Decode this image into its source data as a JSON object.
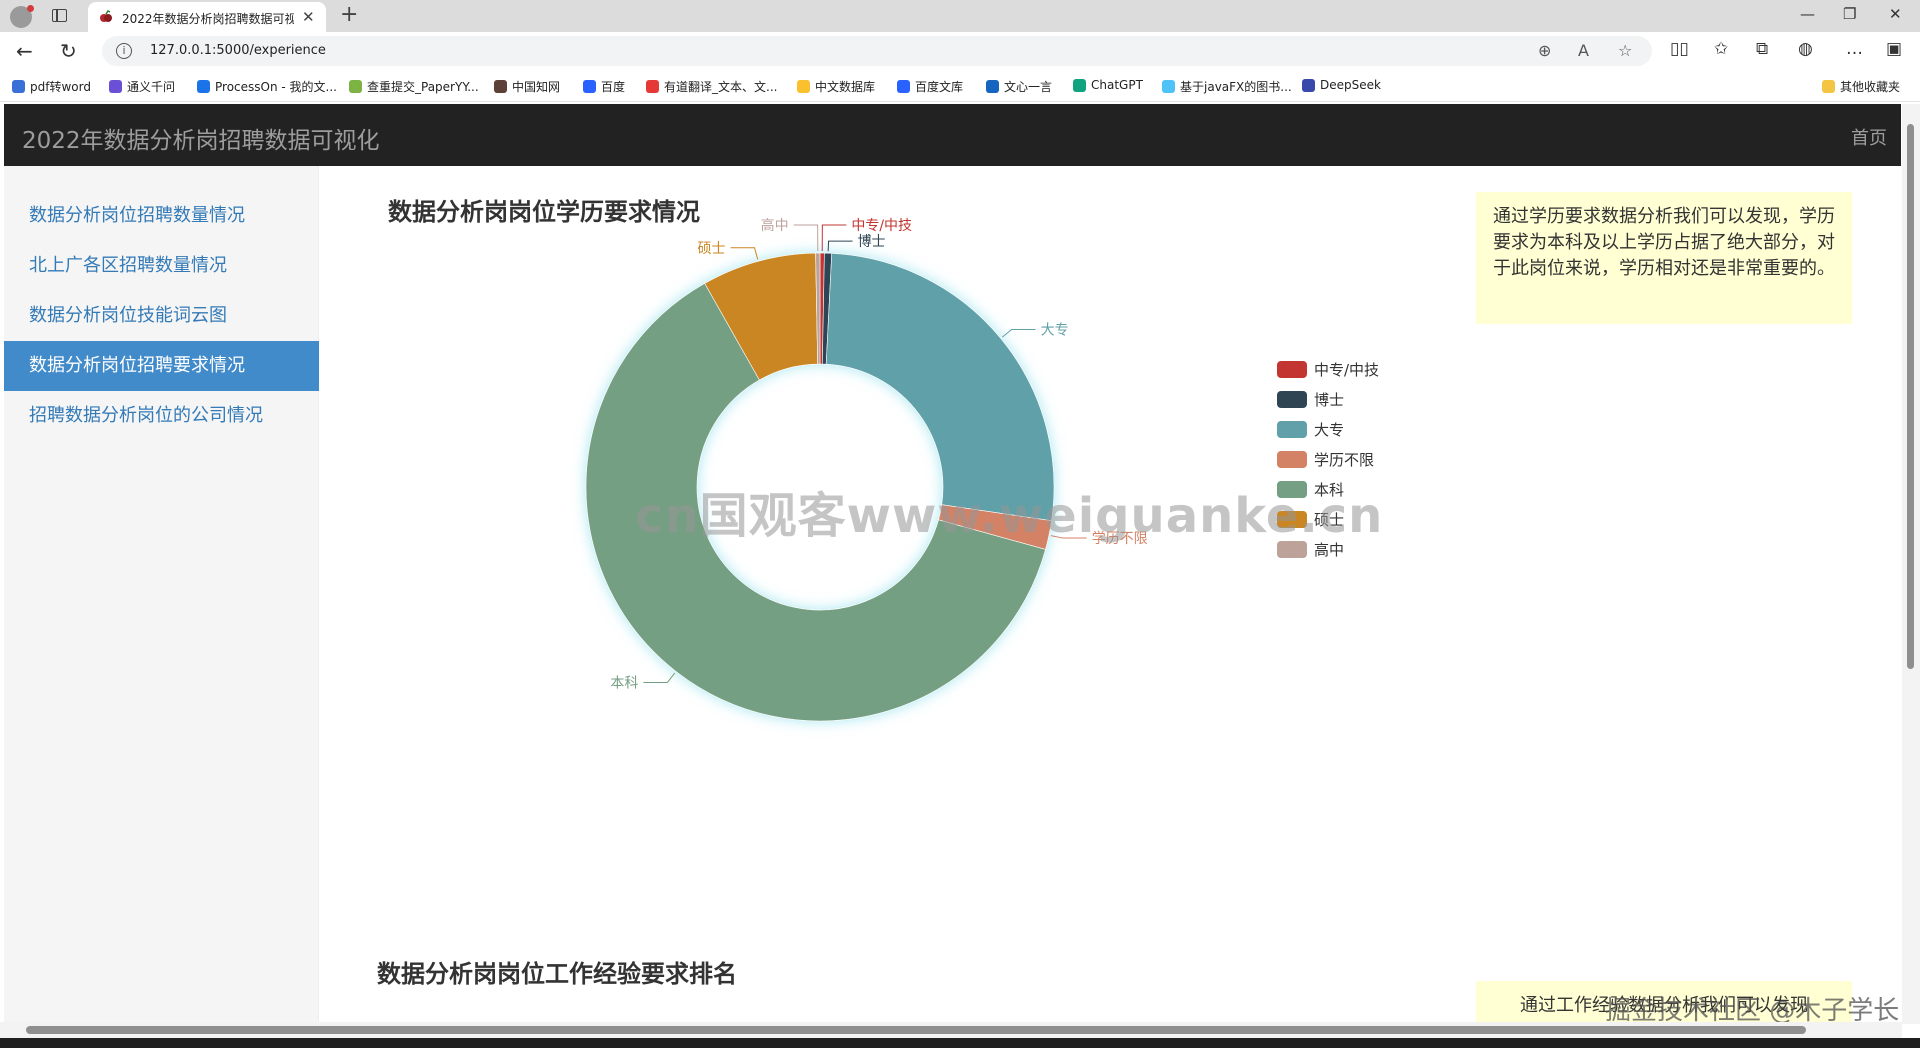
{
  "browser": {
    "tab_title": "2022年数据分析岗招聘数据可视化",
    "url": "127.0.0.1:5000/experience",
    "bookmarks": [
      "pdf转word",
      "通义千问",
      "ProcessOn - 我的文...",
      "查重提交_PaperYY...",
      "中国知网",
      "百度",
      "有道翻译_文本、文...",
      "中文数据库",
      "百度文库",
      "文心一言",
      "ChatGPT",
      "基于javaFX的图书...",
      "DeepSeek"
    ],
    "other_bookmarks": "其他收藏夹"
  },
  "header": {
    "title": "2022年数据分析岗招聘数据可视化",
    "home": "首页"
  },
  "sidebar": {
    "items": [
      {
        "label": "数据分析岗位招聘数量情况"
      },
      {
        "label": "北上广各区招聘数量情况"
      },
      {
        "label": "数据分析岗位技能词云图"
      },
      {
        "label": "数据分析岗位招聘要求情况"
      },
      {
        "label": "招聘数据分析岗位的公司情况"
      }
    ],
    "active_index": 3
  },
  "sections": {
    "education_title": "数据分析岗岗位学历要求情况",
    "education_note": "通过学历要求数据分析我们可以发现，学历要求为本科及以上学历占据了绝大部分，对于此岗位来说，学历相对还是非常重要的。",
    "experience_title": "数据分析岗岗位工作经验要求排名",
    "experience_note": "通过工作经验数据分析我们可以发现"
  },
  "chart_data": {
    "type": "pie",
    "variant": "donut",
    "legend_position": "right",
    "categories": [
      "中专/中技",
      "博士",
      "大专",
      "学历不限",
      "本科",
      "硕士",
      "高中"
    ],
    "values": [
      0.3,
      0.5,
      26.5,
      2.0,
      62.5,
      7.9,
      0.3
    ],
    "colors": [
      "#c23531",
      "#2f4554",
      "#61a0a8",
      "#d48265",
      "#749f83",
      "#ca8622",
      "#bda29a"
    ]
  },
  "overlays": {
    "watermark": "cn国观客www.weiguanke.cn",
    "corner_watermark": "掘金技术社区 @木子学长"
  }
}
